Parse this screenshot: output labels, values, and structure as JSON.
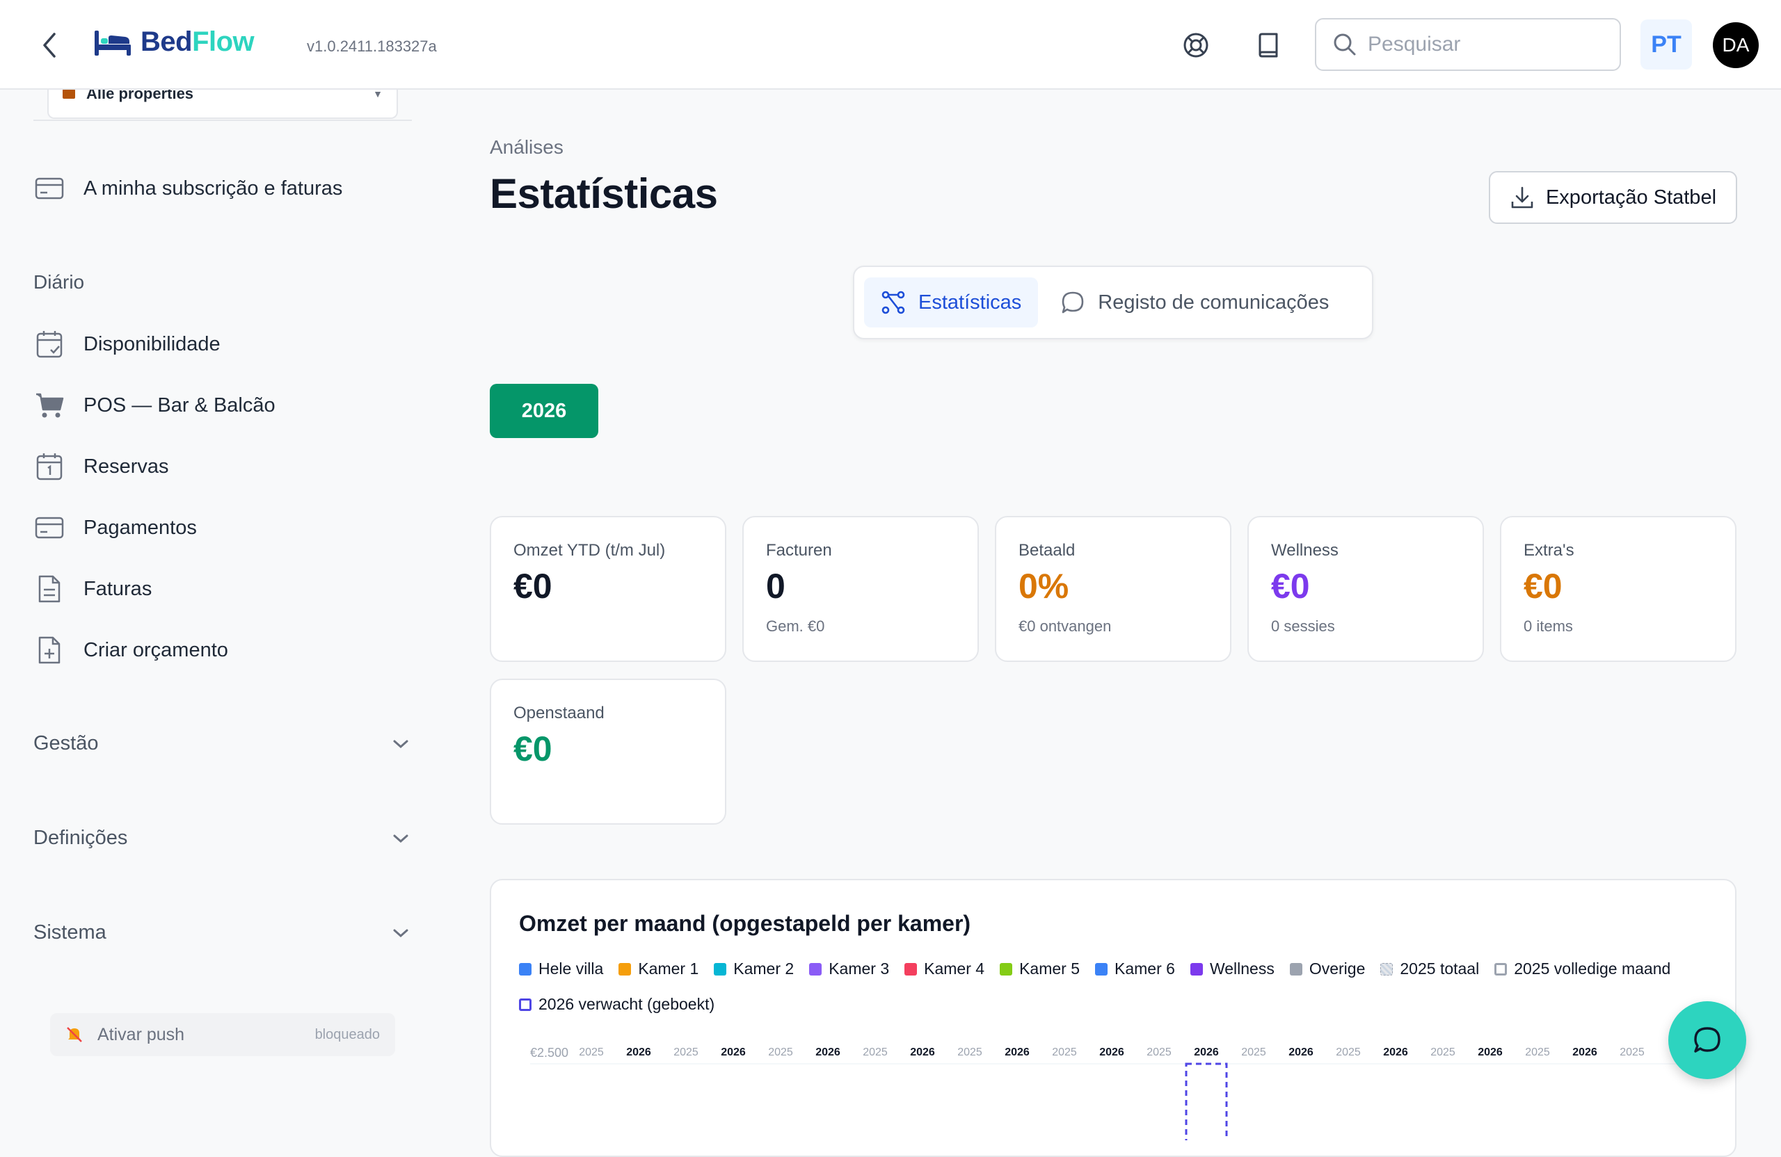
{
  "header": {
    "logo_part1": "Bed",
    "logo_part2": "Flow",
    "version": "v1.0.2411.183327a",
    "search_placeholder": "Pesquisar",
    "language": "PT",
    "avatar_initials": "DA",
    "icons": [
      "back-icon",
      "lifebuoy-icon",
      "book-icon",
      "search-icon"
    ]
  },
  "sidebar": {
    "property_select": "Alle properties",
    "subscription": "A minha subscrição e faturas",
    "daily_heading": "Diário",
    "items": [
      {
        "label": "Disponibilidade",
        "icon": "calendar-check-icon"
      },
      {
        "label": "POS — Bar & Balcão",
        "icon": "cart-icon"
      },
      {
        "label": "Reservas",
        "icon": "calendar-icon"
      },
      {
        "label": "Pagamentos",
        "icon": "credit-card-icon"
      },
      {
        "label": "Faturas",
        "icon": "document-icon"
      },
      {
        "label": "Criar orçamento",
        "icon": "document-plus-icon"
      }
    ],
    "sections": [
      {
        "label": "Gestão"
      },
      {
        "label": "Definições"
      },
      {
        "label": "Sistema"
      }
    ],
    "push": {
      "label": "Ativar push",
      "status": "bloqueado"
    }
  },
  "main": {
    "breadcrumb": "Análises",
    "title": "Estatísticas",
    "export_label": "Exportação Statbel",
    "tabs": [
      {
        "label": "Estatísticas",
        "active": true
      },
      {
        "label": "Registo de comunicações",
        "active": false
      }
    ],
    "year": "2026",
    "kpis": [
      {
        "label": "Omzet YTD (t/m Jul)",
        "value": "€0",
        "sub": "",
        "color": "#111827"
      },
      {
        "label": "Facturen",
        "value": "0",
        "sub": "Gem. €0",
        "color": "#111827"
      },
      {
        "label": "Betaald",
        "value": "0%",
        "sub": "€0 ontvangen",
        "color": "#d97706"
      },
      {
        "label": "Wellness",
        "value": "€0",
        "sub": "0 sessies",
        "color": "#7c3aed"
      },
      {
        "label": "Extra's",
        "value": "€0",
        "sub": "0 items",
        "color": "#d97706"
      },
      {
        "label": "Openstaand",
        "value": "€0",
        "sub": "",
        "color": "#059669"
      }
    ]
  },
  "chart_data": {
    "type": "bar",
    "title": "Omzet per maand (opgestapeld per kamer)",
    "legend": [
      {
        "name": "Hele villa",
        "color": "#3b82f6",
        "style": "solid"
      },
      {
        "name": "Kamer 1",
        "color": "#f59e0b",
        "style": "solid"
      },
      {
        "name": "Kamer 2",
        "color": "#06b6d4",
        "style": "solid"
      },
      {
        "name": "Kamer 3",
        "color": "#8b5cf6",
        "style": "solid"
      },
      {
        "name": "Kamer 4",
        "color": "#f43f5e",
        "style": "solid"
      },
      {
        "name": "Kamer 5",
        "color": "#84cc16",
        "style": "solid"
      },
      {
        "name": "Kamer 6",
        "color": "#3b82f6",
        "style": "solid"
      },
      {
        "name": "Wellness",
        "color": "#7c3aed",
        "style": "solid"
      },
      {
        "name": "Overige",
        "color": "#9ca3af",
        "style": "solid"
      },
      {
        "name": "2025 totaal",
        "color": "#d1d5db",
        "style": "hatched"
      },
      {
        "name": "2025 volledige maand",
        "color": "#9ca3af",
        "style": "outline"
      },
      {
        "name": "2026 verwacht (geboekt)",
        "color": "#4f46e5",
        "style": "outline"
      }
    ],
    "y_tick_top": "€2.500",
    "column_labels": [
      "2025",
      "2026",
      "2025",
      "2026",
      "2025",
      "2026",
      "2025",
      "2026",
      "2025",
      "2026",
      "2025",
      "2026",
      "2025",
      "2026",
      "2025",
      "2026",
      "2025",
      "2026",
      "2025",
      "2026",
      "2025",
      "2026",
      "2025"
    ],
    "highlight_column": 13
  }
}
